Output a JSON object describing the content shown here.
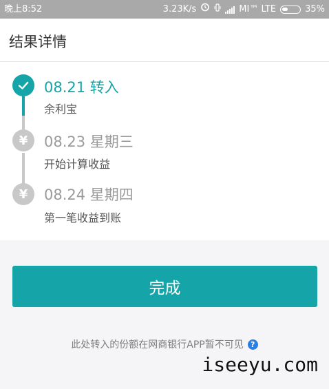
{
  "status_bar": {
    "time": "晚上8:52",
    "network_speed": "3.23K/s",
    "carrier": "MI™ LTE",
    "battery_percent": "35%",
    "battery_level": 0.35
  },
  "header": {
    "title": "结果详情"
  },
  "timeline": [
    {
      "date": "08.21 转入",
      "desc": "余利宝",
      "state": "done"
    },
    {
      "date": "08.23 星期三",
      "desc": "开始计算收益",
      "state": "pending"
    },
    {
      "date": "08.24 星期四",
      "desc": "第一笔收益到账",
      "state": "pending"
    }
  ],
  "yuan_symbol": "¥",
  "done_button": {
    "label": "完成"
  },
  "notice": {
    "text": "此处转入的份额在网商银行APP暂不可见",
    "help_symbol": "?"
  },
  "watermark": "iseeyu.com",
  "colors": {
    "accent": "#15a5a9",
    "pending": "#c8c8c8",
    "status_bar": "#a9a9a9"
  }
}
